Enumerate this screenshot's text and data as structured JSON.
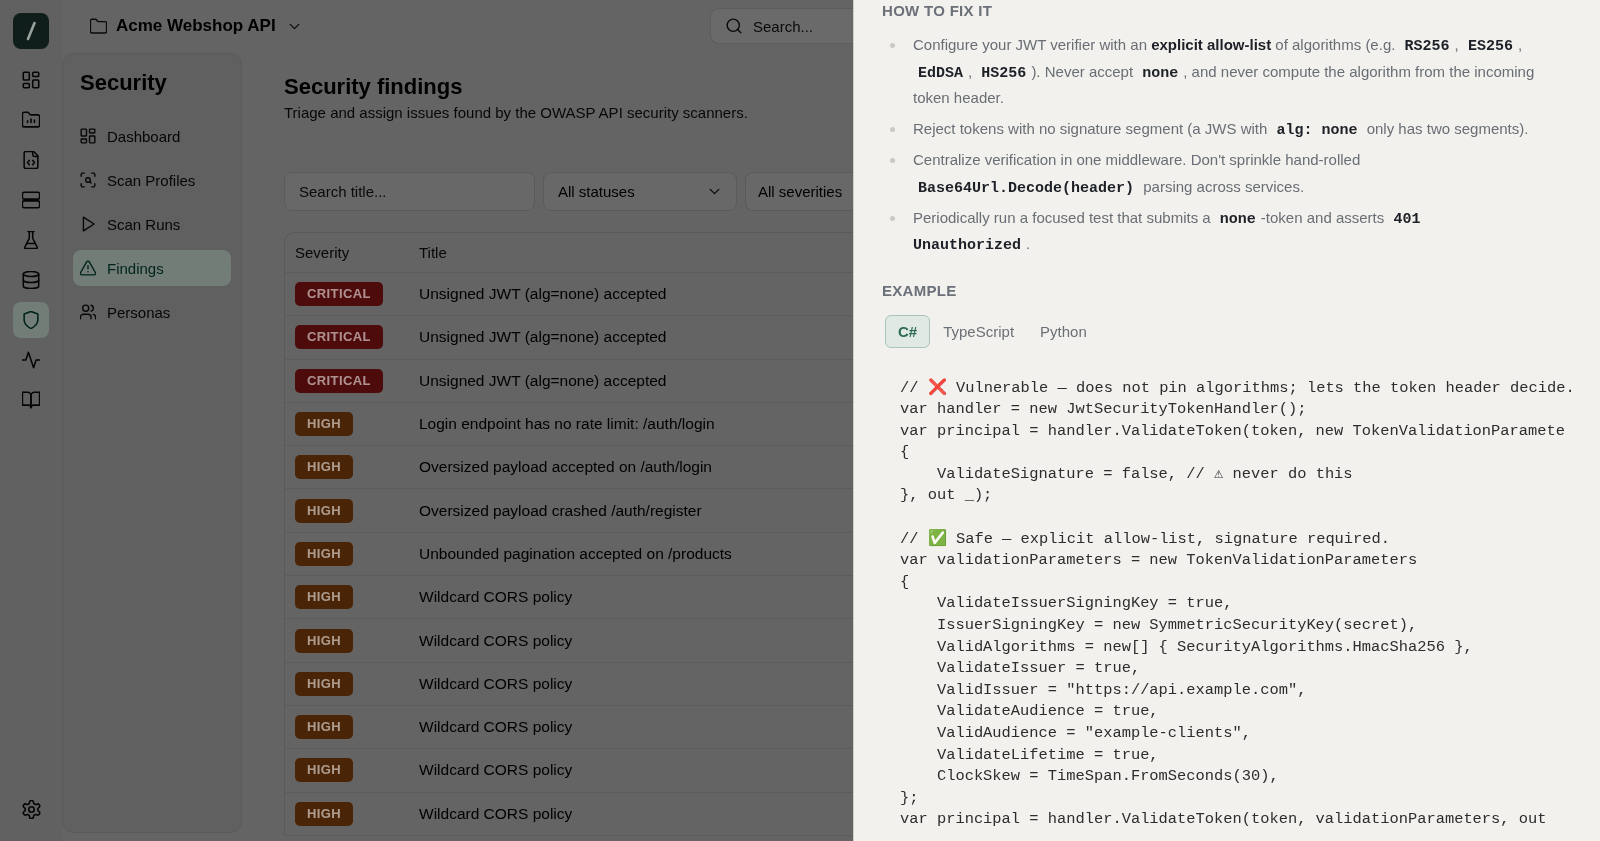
{
  "rail": {
    "items": [
      {
        "kind": "grid",
        "selected": false
      },
      {
        "kind": "folder",
        "selected": false
      },
      {
        "kind": "file-code",
        "selected": false
      },
      {
        "kind": "server",
        "selected": false
      },
      {
        "kind": "flask",
        "selected": false
      },
      {
        "kind": "database",
        "selected": false
      },
      {
        "kind": "shield",
        "selected": true
      },
      {
        "kind": "pulse",
        "selected": false
      },
      {
        "kind": "book",
        "selected": false
      }
    ]
  },
  "header": {
    "project": "Acme Webshop API",
    "search": {
      "placeholder": "Search..."
    }
  },
  "sidebar": {
    "title": "Security",
    "items": [
      {
        "label": "Dashboard",
        "kind": "grid",
        "selected": false
      },
      {
        "label": "Scan Profiles",
        "kind": "scan",
        "selected": false
      },
      {
        "label": "Scan Runs",
        "kind": "play",
        "selected": false
      },
      {
        "label": "Findings",
        "kind": "warning",
        "selected": true
      },
      {
        "label": "Personas",
        "kind": "users",
        "selected": false
      }
    ]
  },
  "page": {
    "title": "Security findings",
    "subtitle": "Triage and assign issues found by the OWASP API security scanners."
  },
  "filters": {
    "search": {
      "placeholder": "Search title..."
    },
    "status": {
      "value": "All statuses"
    },
    "severity": {
      "value": "All severities"
    }
  },
  "table": {
    "columns": [
      "Severity",
      "Title"
    ],
    "rows": [
      {
        "severity": "CRITICAL",
        "color": "#4e0b0b",
        "title": "Unsigned JWT (alg=none) accepted"
      },
      {
        "severity": "CRITICAL",
        "color": "#4e0b0b",
        "title": "Unsigned JWT (alg=none) accepted"
      },
      {
        "severity": "CRITICAL",
        "color": "#4e0b0b",
        "title": "Unsigned JWT (alg=none) accepted"
      },
      {
        "severity": "HIGH",
        "color": "#4a2406",
        "title": "Login endpoint has no rate limit: /auth/login"
      },
      {
        "severity": "HIGH",
        "color": "#4a2406",
        "title": "Oversized payload accepted on /auth/login"
      },
      {
        "severity": "HIGH",
        "color": "#4a2406",
        "title": "Oversized payload crashed /auth/register"
      },
      {
        "severity": "HIGH",
        "color": "#4a2406",
        "title": "Unbounded pagination accepted on /products"
      },
      {
        "severity": "HIGH",
        "color": "#4a2406",
        "title": "Wildcard CORS policy"
      },
      {
        "severity": "HIGH",
        "color": "#4a2406",
        "title": "Wildcard CORS policy"
      },
      {
        "severity": "HIGH",
        "color": "#4a2406",
        "title": "Wildcard CORS policy"
      },
      {
        "severity": "HIGH",
        "color": "#4a2406",
        "title": "Wildcard CORS policy"
      },
      {
        "severity": "HIGH",
        "color": "#4a2406",
        "title": "Wildcard CORS policy"
      },
      {
        "severity": "HIGH",
        "color": "#4a2406",
        "title": "Wildcard CORS policy"
      }
    ]
  },
  "drawer": {
    "fix": {
      "heading": "HOW TO FIX IT",
      "steps": [
        {
          "parts": [
            {
              "kind": "text",
              "text": "Configure your JWT verifier with an "
            },
            {
              "kind": "strong",
              "text": "explicit allow-list"
            },
            {
              "kind": "text",
              "text": " of algorithms (e.g. "
            },
            {
              "kind": "code",
              "text": "RS256"
            },
            {
              "kind": "text",
              "text": ", "
            },
            {
              "kind": "code",
              "text": "ES256"
            },
            {
              "kind": "text",
              "text": ", "
            },
            {
              "kind": "code",
              "text": "EdDSA"
            },
            {
              "kind": "text",
              "text": ", "
            },
            {
              "kind": "code",
              "text": "HS256"
            },
            {
              "kind": "text",
              "text": "). Never accept "
            },
            {
              "kind": "code",
              "text": "none"
            },
            {
              "kind": "text",
              "text": ", and never compute the algorithm from the incoming token header."
            }
          ]
        },
        {
          "parts": [
            {
              "kind": "text",
              "text": "Reject tokens with no signature segment (a JWS with "
            },
            {
              "kind": "code",
              "text": "alg: none"
            },
            {
              "kind": "text",
              "text": " only has two segments)."
            }
          ]
        },
        {
          "parts": [
            {
              "kind": "text",
              "text": "Centralize verification in one middleware. Don't sprinkle hand-rolled "
            },
            {
              "kind": "code",
              "text": "Base64Url.Decode(header)"
            },
            {
              "kind": "text",
              "text": " parsing across services."
            }
          ]
        },
        {
          "parts": [
            {
              "kind": "text",
              "text": "Periodically run a focused test that submits a "
            },
            {
              "kind": "code",
              "text": "none"
            },
            {
              "kind": "text",
              "text": "-token and asserts "
            },
            {
              "kind": "code",
              "text": "401 Unauthorized"
            },
            {
              "kind": "text",
              "text": "."
            }
          ]
        }
      ]
    },
    "example": {
      "heading": "EXAMPLE",
      "tabs": [
        {
          "label": "C#",
          "selected": true
        },
        {
          "label": "TypeScript",
          "selected": false
        },
        {
          "label": "Python",
          "selected": false
        }
      ],
      "code": "// ❌ Vulnerable — does not pin algorithms; lets the token header decide.\nvar handler = new JwtSecurityTokenHandler();\nvar principal = handler.ValidateToken(token, new TokenValidationParamete\n{\n    ValidateSignature = false, // ⚠ never do this\n}, out _);\n\n// ✅ Safe — explicit allow-list, signature required.\nvar validationParameters = new TokenValidationParameters\n{\n    ValidateIssuerSigningKey = true,\n    IssuerSigningKey = new SymmetricSecurityKey(secret),\n    ValidAlgorithms = new[] { SecurityAlgorithms.HmacSha256 },\n    ValidateIssuer = true,\n    ValidIssuer = \"https://api.example.com\",\n    ValidateAudience = true,\n    ValidAudience = \"example-clients\",\n    ValidateLifetime = true,\n    ClockSkew = TimeSpan.FromSeconds(30),\n};\nvar principal = handler.ValidateToken(token, validationParameters, out"
    }
  }
}
